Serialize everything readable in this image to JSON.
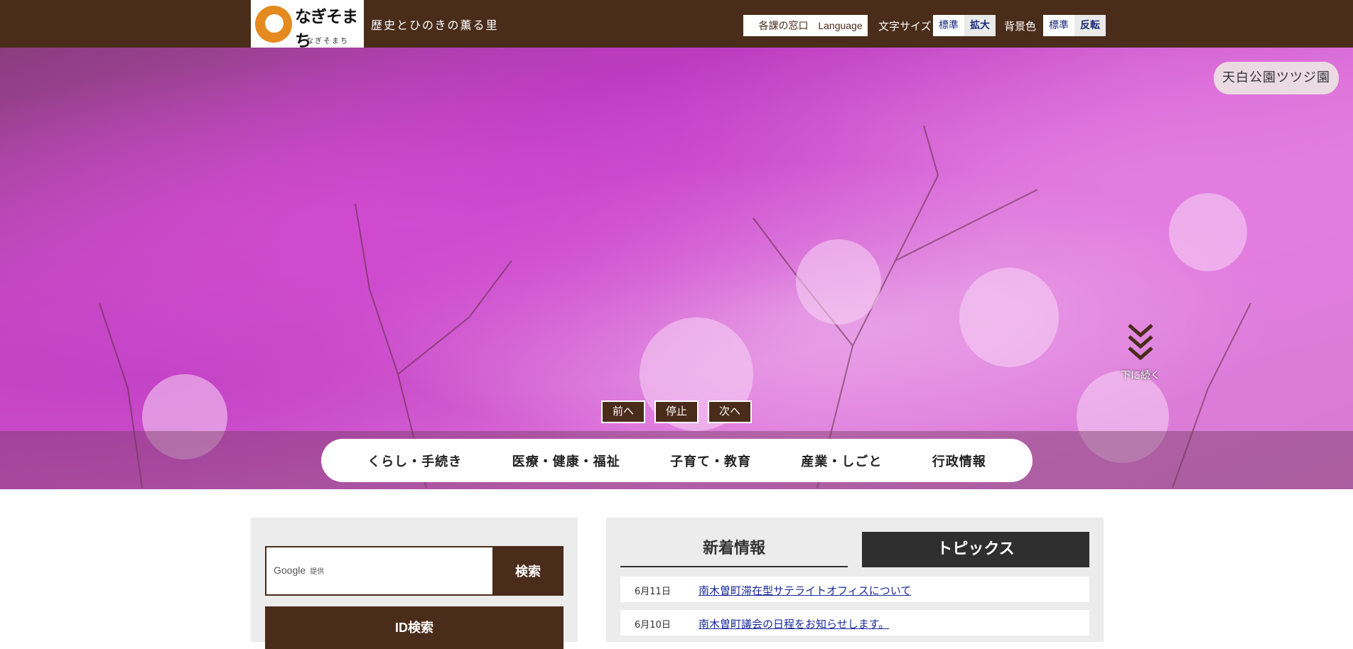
{
  "header": {
    "logo_title": "なぎそまち",
    "logo_subtitle": "なぎそまち",
    "tagline": "歴史とひのきの薫る里",
    "departments_btn": "各課の窓口",
    "language_btn": "Language",
    "font_size_label": "文字サイズ",
    "font_size_options": [
      "標準",
      "拡大"
    ],
    "bg_color_label": "背景色",
    "bg_color_options": [
      "標準",
      "反転"
    ]
  },
  "hero": {
    "caption": "天白公園ツツジ園",
    "scroll_hint": "下に続く",
    "slider_controls": {
      "prev": "前へ",
      "stop": "停止",
      "next": "次へ"
    }
  },
  "nav": {
    "items": [
      "くらし・手続き",
      "医療・健康・福祉",
      "子育て・教育",
      "産業・しごと",
      "行政情報"
    ]
  },
  "search": {
    "google_label": "Google",
    "provided_label": "提供",
    "search_btn": "検索",
    "id_search_btn": "ID検索"
  },
  "news": {
    "tabs": [
      "新着情報",
      "トピックス"
    ],
    "items": [
      {
        "date": "6月11日",
        "title": "南木曽町滞在型サテライトオフィスについて"
      },
      {
        "date": "6月10日",
        "title": "南木曽町議会の日程をお知らせします。"
      }
    ]
  },
  "colors": {
    "brand_brown": "#4a2c1a",
    "accent_orange": "#e58a1e",
    "link_blue": "#1a2a9a"
  }
}
